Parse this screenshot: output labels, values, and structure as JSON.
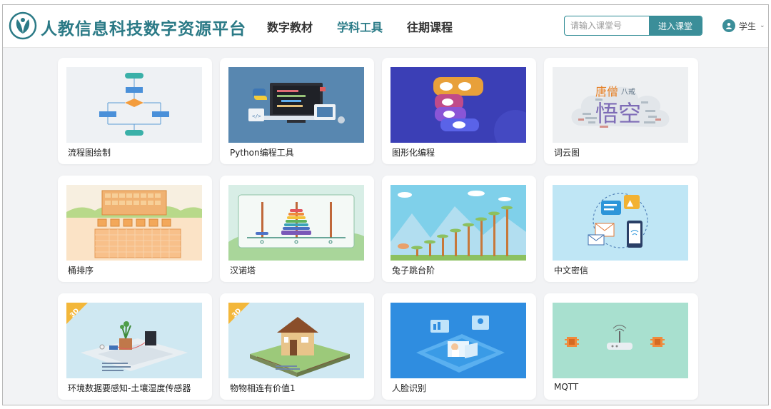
{
  "header": {
    "site_title": "人教信息科技数字资源平台",
    "nav": [
      {
        "label": "数字教材",
        "active": false
      },
      {
        "label": "学科工具",
        "active": true
      },
      {
        "label": "往期课程",
        "active": false
      }
    ],
    "search": {
      "placeholder": "请输入课堂号",
      "value": ""
    },
    "join_button": "进入课堂",
    "user_label": "学生"
  },
  "cards": [
    {
      "label": "流程图绘制",
      "icon": "flowchart-thumbnail"
    },
    {
      "label": "Python编程工具",
      "icon": "python-thumbnail"
    },
    {
      "label": "图形化编程",
      "icon": "block-coding-thumbnail"
    },
    {
      "label": "词云图",
      "icon": "word-cloud-thumbnail",
      "words": [
        "唐僧",
        "八戒",
        "悟空"
      ]
    },
    {
      "label": "桶排序",
      "icon": "bucket-sort-thumbnail"
    },
    {
      "label": "汉诺塔",
      "icon": "hanoi-thumbnail"
    },
    {
      "label": "兔子跳台阶",
      "icon": "rabbit-stairs-thumbnail"
    },
    {
      "label": "中文密信",
      "icon": "secret-message-thumbnail"
    },
    {
      "label": "环境数据要感知-土壤湿度传感器",
      "icon": "soil-sensor-thumbnail",
      "badge": "3D"
    },
    {
      "label": "物物相连有价值1",
      "icon": "iot-house-thumbnail",
      "badge": "3D"
    },
    {
      "label": "人脸识别",
      "icon": "face-recognition-thumbnail"
    },
    {
      "label": "MQTT",
      "icon": "mqtt-thumbnail"
    }
  ],
  "colors": {
    "accent": "#2a7b87",
    "button": "#3b8e99",
    "background": "#f2f3f5"
  }
}
